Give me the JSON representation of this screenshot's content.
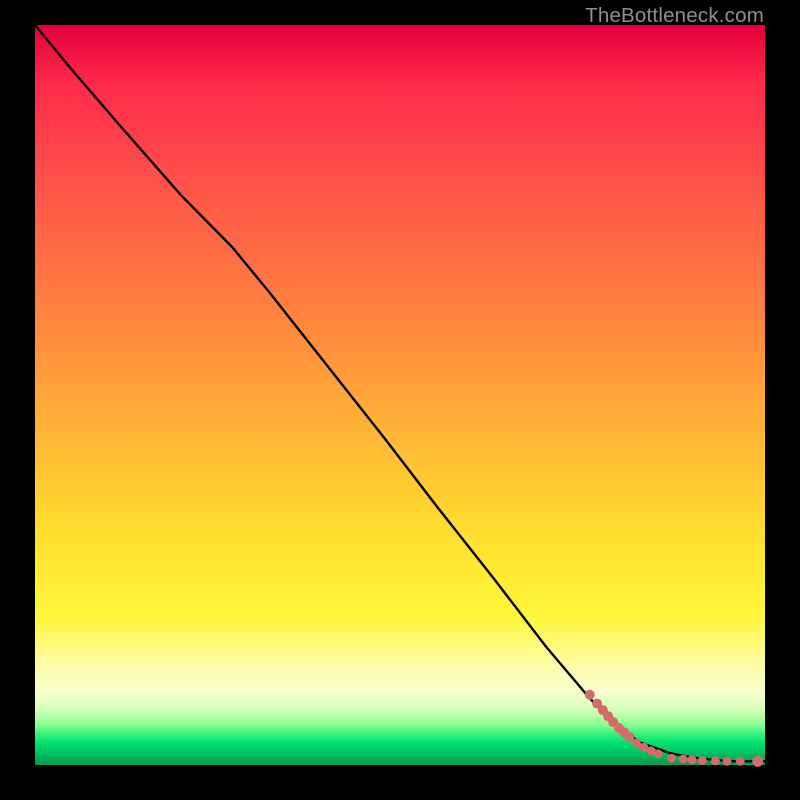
{
  "credit": "TheBottleneck.com",
  "chart_data": {
    "type": "line",
    "title": "",
    "xlabel": "",
    "ylabel": "",
    "xlim": [
      0,
      100
    ],
    "ylim": [
      0,
      100
    ],
    "series": [
      {
        "name": "curve",
        "x": [
          0,
          5,
          12,
          20,
          27,
          32,
          40,
          48,
          55,
          63,
          70,
          76,
          80,
          83,
          87,
          90,
          93,
          96,
          100
        ],
        "y": [
          100,
          94,
          86,
          77,
          70,
          64,
          54,
          44,
          35,
          25,
          16,
          9,
          5,
          3,
          1.6,
          1.0,
          0.7,
          0.5,
          0.5
        ]
      }
    ],
    "marker_clusters": [
      {
        "name": "upper-diag-cluster",
        "color": "#d46a6a",
        "points": [
          {
            "x": 76.0,
            "y": 9.5,
            "r": 5
          },
          {
            "x": 77.0,
            "y": 8.3,
            "r": 5
          },
          {
            "x": 77.8,
            "y": 7.4,
            "r": 5
          },
          {
            "x": 78.5,
            "y": 6.6,
            "r": 5
          },
          {
            "x": 79.2,
            "y": 5.8,
            "r": 5
          },
          {
            "x": 80.0,
            "y": 5.0,
            "r": 5
          },
          {
            "x": 80.7,
            "y": 4.4,
            "r": 5
          },
          {
            "x": 81.4,
            "y": 3.8,
            "r": 5
          },
          {
            "x": 82.4,
            "y": 3.0,
            "r": 4.5
          },
          {
            "x": 83.4,
            "y": 2.4,
            "r": 4.5
          },
          {
            "x": 84.4,
            "y": 1.9,
            "r": 4.5
          },
          {
            "x": 85.4,
            "y": 1.5,
            "r": 4.5
          }
        ]
      },
      {
        "name": "baseline-cluster",
        "color": "#d46a6a",
        "points": [
          {
            "x": 87.2,
            "y": 0.9,
            "r": 4.5
          },
          {
            "x": 88.8,
            "y": 0.8,
            "r": 4.5
          },
          {
            "x": 90.0,
            "y": 0.7,
            "r": 4.5
          },
          {
            "x": 91.4,
            "y": 0.6,
            "r": 4.5
          },
          {
            "x": 93.2,
            "y": 0.55,
            "r": 4.5
          },
          {
            "x": 94.8,
            "y": 0.5,
            "r": 4.5
          },
          {
            "x": 96.6,
            "y": 0.5,
            "r": 4.5
          },
          {
            "x": 99.0,
            "y": 0.5,
            "r": 5.5
          }
        ]
      }
    ],
    "background_gradient": {
      "top": "#e4003b",
      "mid": "#ffe22e",
      "bottom": "#009a4e"
    }
  }
}
